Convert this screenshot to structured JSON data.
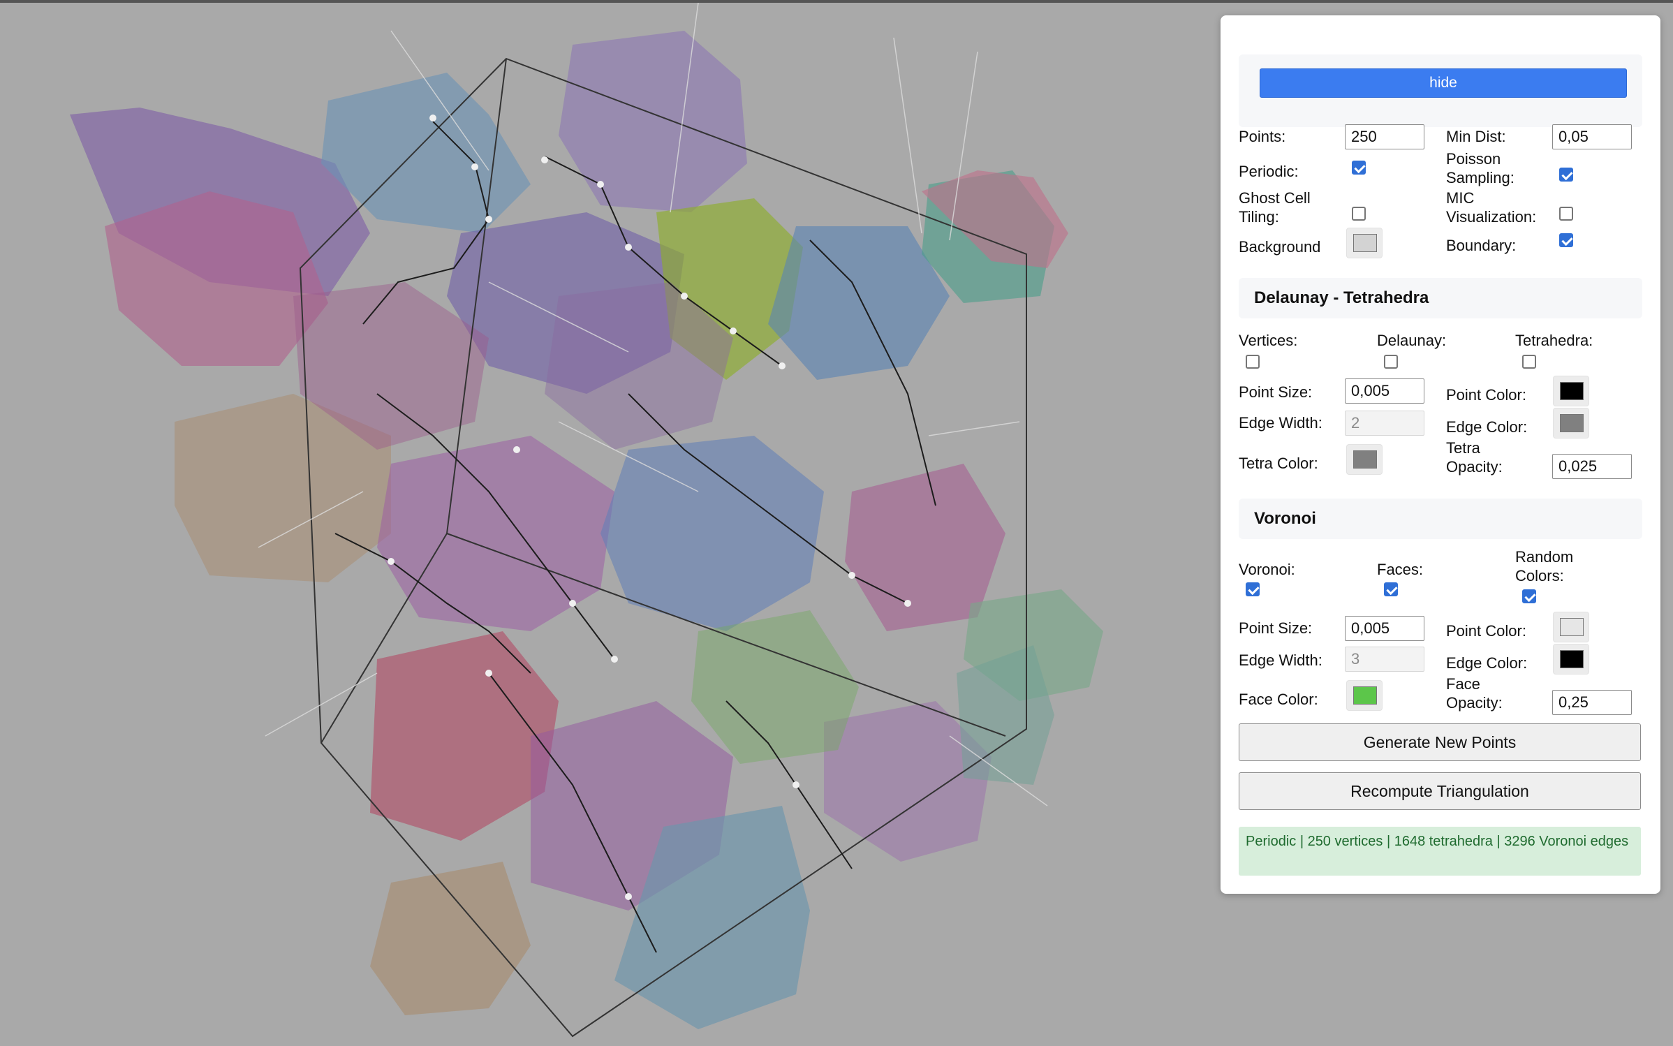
{
  "panel": {
    "hide_label": "hide",
    "general": {
      "points_label": "Points:",
      "points_value": "250",
      "min_dist_label": "Min Dist:",
      "min_dist_value": "0,05",
      "periodic_label": "Periodic:",
      "periodic_checked": true,
      "poisson_label": "Poisson Sampling:",
      "poisson_checked": true,
      "ghost_label": "Ghost Cell Tiling:",
      "ghost_checked": false,
      "mic_label": "MIC Visualization:",
      "mic_checked": false,
      "background_label": "Background",
      "background_color": "#d3d3d3",
      "boundary_label": "Boundary:",
      "boundary_checked": true
    },
    "delaunay": {
      "title": "Delaunay - Tetrahedra",
      "vertices_label": "Vertices:",
      "vertices_checked": false,
      "delaunay_label": "Delaunay:",
      "delaunay_checked": false,
      "tetrahedra_label": "Tetrahedra:",
      "tetrahedra_checked": false,
      "point_size_label": "Point Size:",
      "point_size_value": "0,005",
      "point_color_label": "Point Color:",
      "point_color": "#000000",
      "edge_width_label": "Edge Width:",
      "edge_width_value": "2",
      "edge_color_label": "Edge Color:",
      "edge_color": "#808080",
      "tetra_color_label": "Tetra Color:",
      "tetra_color": "#808080",
      "tetra_opacity_label": "Tetra Opacity:",
      "tetra_opacity_value": "0,025"
    },
    "voronoi": {
      "title": "Voronoi",
      "voronoi_label": "Voronoi:",
      "voronoi_checked": true,
      "faces_label": "Faces:",
      "faces_checked": true,
      "random_colors_label": "Random Colors:",
      "random_colors_checked": true,
      "point_size_label": "Point Size:",
      "point_size_value": "0,005",
      "point_color_label": "Point Color:",
      "point_color": "#e6e6e6",
      "edge_width_label": "Edge Width:",
      "edge_width_value": "3",
      "edge_color_label": "Edge Color:",
      "edge_color": "#000000",
      "face_color_label": "Face Color:",
      "face_color": "#5cc64a",
      "face_opacity_label": "Face Opacity:",
      "face_opacity_value": "0,25"
    },
    "generate_label": "Generate New Points",
    "recompute_label": "Recompute Triangulation",
    "status_text": "Periodic | 250 vertices | 1648 tetrahedra | 3296 Voronoi edges"
  }
}
